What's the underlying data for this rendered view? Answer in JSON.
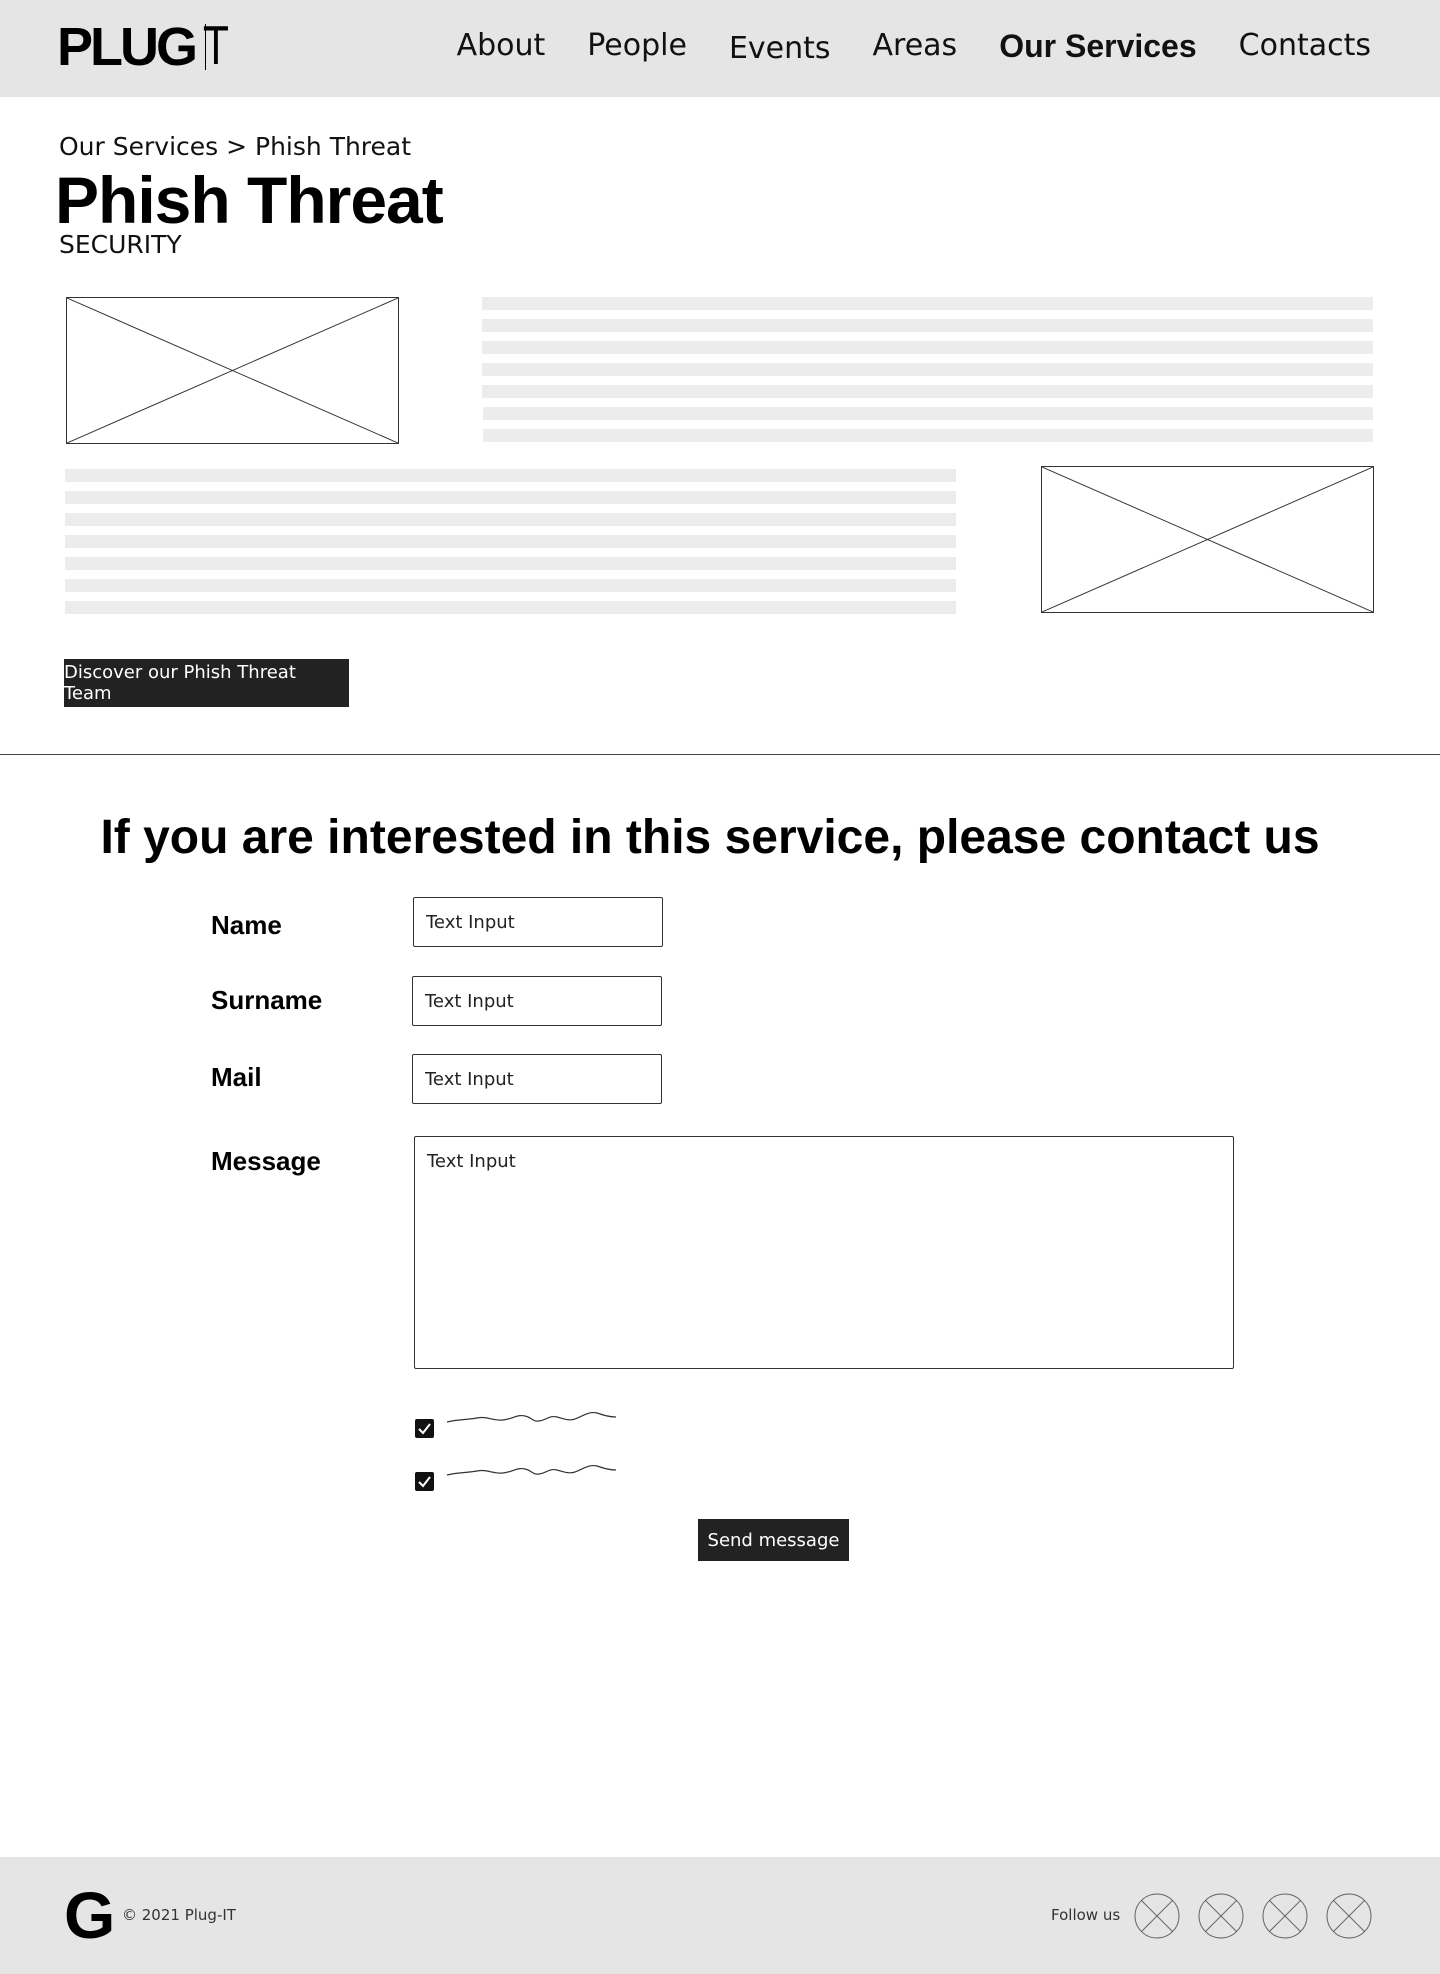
{
  "header": {
    "logo_bold": "PLUG",
    "logo_thin": "T",
    "nav": [
      {
        "label": "About"
      },
      {
        "label": "People"
      },
      {
        "label": "Events"
      },
      {
        "label": "Areas"
      },
      {
        "label": "Our Services",
        "active": true
      },
      {
        "label": "Contacts"
      }
    ]
  },
  "page": {
    "breadcrumb": "Our Services > Phish Threat",
    "title": "Phish Threat",
    "subtitle": "SECURITY",
    "team_button": "Discover our Phish Threat Team"
  },
  "contact": {
    "heading": "If you are interested in this service, please contact us",
    "fields": {
      "name_label": "Name",
      "name_value": "Text Input",
      "surname_label": "Surname",
      "surname_value": "Text Input",
      "mail_label": "Mail",
      "mail_value": "Text Input",
      "message_label": "Message",
      "message_value": "Text Input"
    },
    "checkboxes": [
      {
        "checked": true
      },
      {
        "checked": true
      }
    ],
    "send_button": "Send message"
  },
  "footer": {
    "logo": "G",
    "copyright": "© 2021 Plug-IT",
    "follow_label": "Follow us",
    "social_icons": [
      "social-icon-1",
      "social-icon-2",
      "social-icon-3",
      "social-icon-4"
    ]
  },
  "colors": {
    "header_bg": "#e5e5e5",
    "button_bg": "#222222",
    "placeholder_line": "#ececec"
  }
}
